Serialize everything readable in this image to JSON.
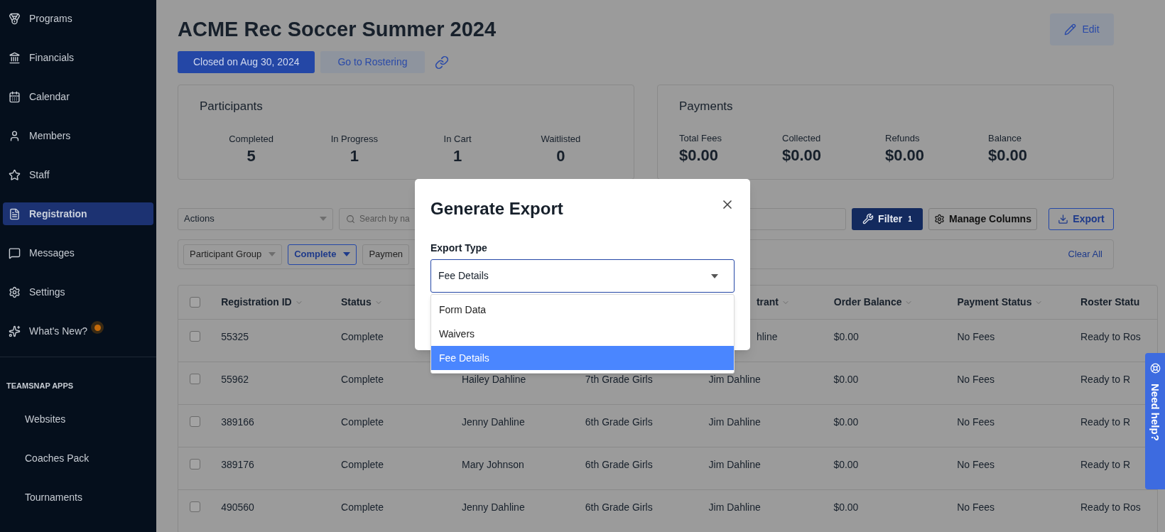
{
  "sidebar": {
    "items": [
      {
        "label": "Programs",
        "selected": false,
        "dot": false
      },
      {
        "label": "Financials",
        "selected": false,
        "dot": false
      },
      {
        "label": "Calendar",
        "selected": false,
        "dot": false
      },
      {
        "label": "Members",
        "selected": false,
        "dot": false
      },
      {
        "label": "Staff",
        "selected": false,
        "dot": false
      },
      {
        "label": "Registration",
        "selected": true,
        "dot": false
      },
      {
        "label": "Messages",
        "selected": false,
        "dot": false
      },
      {
        "label": "Settings",
        "selected": false,
        "dot": false
      },
      {
        "label": "What's New?",
        "selected": false,
        "dot": true
      }
    ],
    "apps_heading": "TEAMSNAP APPS",
    "apps": [
      {
        "label": "Websites"
      },
      {
        "label": "Coaches Pack"
      },
      {
        "label": "Tournaments"
      }
    ]
  },
  "header": {
    "title": "ACME Rec Soccer Summer 2024",
    "status_button": "Closed on Aug 30, 2024",
    "rostering_button": "Go to Rostering",
    "edit_button": "Edit"
  },
  "participants": {
    "title": "Participants",
    "stats": [
      {
        "label": "Completed",
        "value": "5"
      },
      {
        "label": "In Progress",
        "value": "1"
      },
      {
        "label": "In Cart",
        "value": "1"
      },
      {
        "label": "Waitlisted",
        "value": "0"
      }
    ]
  },
  "payments": {
    "title": "Payments",
    "stats": [
      {
        "label": "Total Fees",
        "value": "$0.00"
      },
      {
        "label": "Collected",
        "value": "$0.00"
      },
      {
        "label": "Refunds",
        "value": "$0.00"
      },
      {
        "label": "Balance",
        "value": "$0.00"
      }
    ]
  },
  "toolbar": {
    "actions": "Actions",
    "search_placeholder": "Search by na",
    "filter": "Filter",
    "filter_count": "1",
    "manage_columns": "Manage Columns",
    "export": "Export"
  },
  "chips": [
    {
      "label": "Participant Group",
      "active": false,
      "caret": true
    },
    {
      "label": "Complete",
      "active": true,
      "caret": true
    },
    {
      "label": "Paymen",
      "active": false,
      "caret": false
    }
  ],
  "clear_all": "Clear All",
  "table": {
    "header_checked": false,
    "columns": [
      {
        "label": "Registration ID",
        "sortable": true
      },
      {
        "label": "Status",
        "sortable": true
      },
      {},
      {},
      {
        "label": "trant",
        "sortable": true
      },
      {
        "label": "Order Balance",
        "sortable": true
      },
      {
        "label": "Payment Status",
        "sortable": true
      },
      {
        "label": "Roster Statu",
        "sortable": false
      }
    ],
    "rows": [
      {
        "checked": false,
        "cells": [
          "55325",
          "Complete",
          null,
          null,
          "hline",
          "$0.00",
          "No Fees",
          "Ready to Ros"
        ]
      },
      {
        "checked": false,
        "cells": [
          "55962",
          "Complete",
          "Hailey Dahline",
          "7th Grade Girls",
          "Jim Dahline",
          "$0.00",
          "No Fees",
          "Ready to R"
        ]
      },
      {
        "checked": false,
        "cells": [
          "389166",
          "Complete",
          "Jenny Dahline",
          "6th Grade Girls",
          "Jim Dahline",
          "$0.00",
          "No Fees",
          "Ready to R"
        ]
      },
      {
        "checked": false,
        "cells": [
          "389176",
          "Complete",
          "Mary Johnson",
          "6th Grade Girls",
          "Jim Dahline",
          "$0.00",
          "No Fees",
          "Ready to R"
        ]
      },
      {
        "checked": false,
        "cells": [
          "490560",
          "Complete",
          "Jenny Dahline",
          "6th Grade Girls",
          "Jim Dahline",
          "$0.00",
          "No Fees",
          "Ready to Ros"
        ]
      }
    ]
  },
  "modal": {
    "title": "Generate Export",
    "field_label": "Export Type",
    "value": "Fee Details",
    "options": [
      {
        "label": "Form Data",
        "selected": false
      },
      {
        "label": "Waivers",
        "selected": false
      },
      {
        "label": "Fee Details",
        "selected": true
      }
    ]
  },
  "help_tab": "Need help?"
}
